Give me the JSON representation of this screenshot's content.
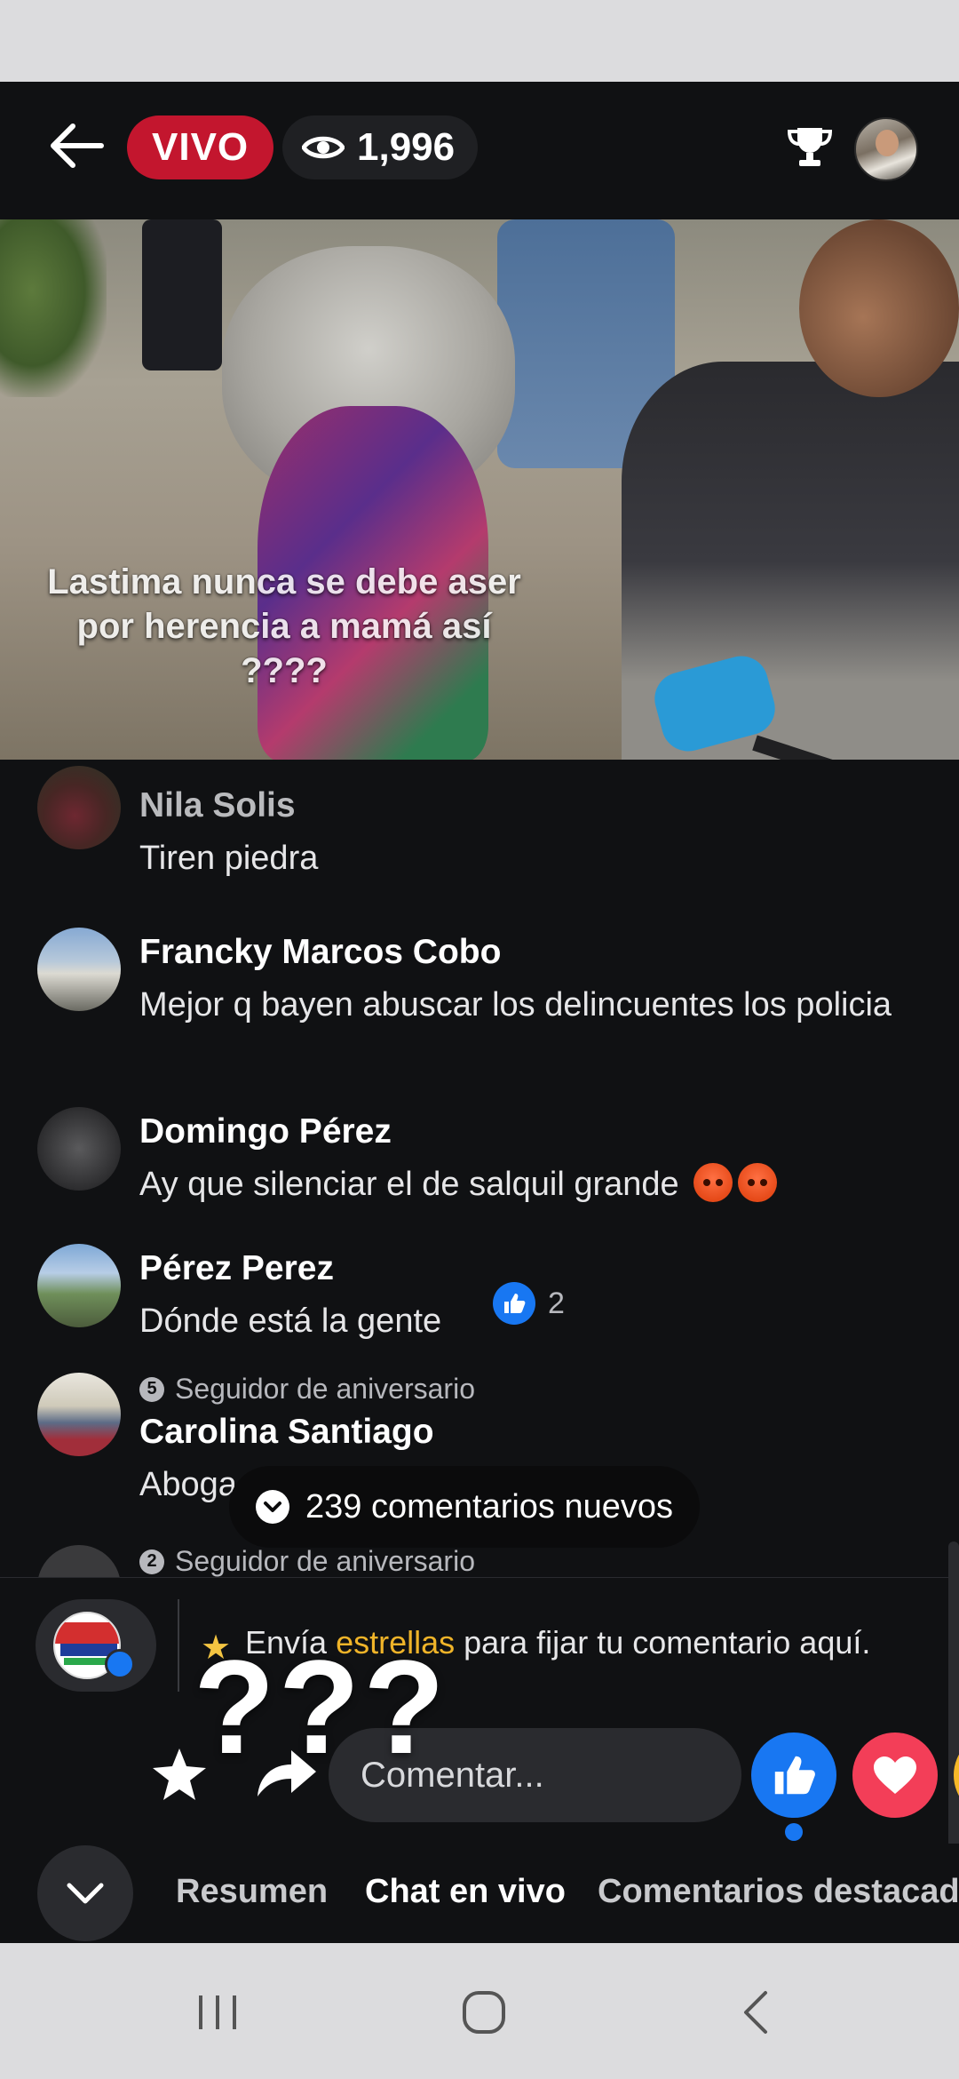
{
  "header": {
    "live_label": "VIVO",
    "viewer_count": "1,996"
  },
  "video": {
    "caption": "Lastima nunca se debe aser por herencia a mamá así ????"
  },
  "comments": [
    {
      "name": "Nila Solis",
      "text": "Tiren piedra",
      "badge": ""
    },
    {
      "name": "Francky Marcos Cobo",
      "text": "Mejor q  bayen abuscar los delincuentes los policia",
      "badge": ""
    },
    {
      "name": "Domingo Pérez",
      "text": "Ay que silenciar el de salquil grande",
      "badge": ""
    },
    {
      "name": "Pérez Perez",
      "text": "Dónde está la gente",
      "badge": "",
      "reactions": "2"
    },
    {
      "name": "Carolina Santiago",
      "text": "Abogado corruptos policía tayin",
      "badge": "Seguidor de aniversario",
      "badge_number": "5"
    },
    {
      "name": "",
      "text": "",
      "badge": "Seguidor de aniversario",
      "badge_number": "2"
    }
  ],
  "new_comments": "239 comentarios nuevos",
  "composer": {
    "stars_prefix": "Envía ",
    "stars_link": "estrellas",
    "stars_suffix": " para fijar tu comentario aquí.",
    "placeholder": "Comentar...",
    "overlay": "???"
  },
  "tabs": [
    {
      "label": "Resumen",
      "active": false
    },
    {
      "label": "Chat en vivo",
      "active": true
    },
    {
      "label": "Comentarios destacados",
      "active": false
    }
  ],
  "colors": {
    "live_red": "#c3162e",
    "facebook_blue": "#1877f2",
    "love_red": "#f33e58",
    "stars_gold": "#f0b429"
  }
}
